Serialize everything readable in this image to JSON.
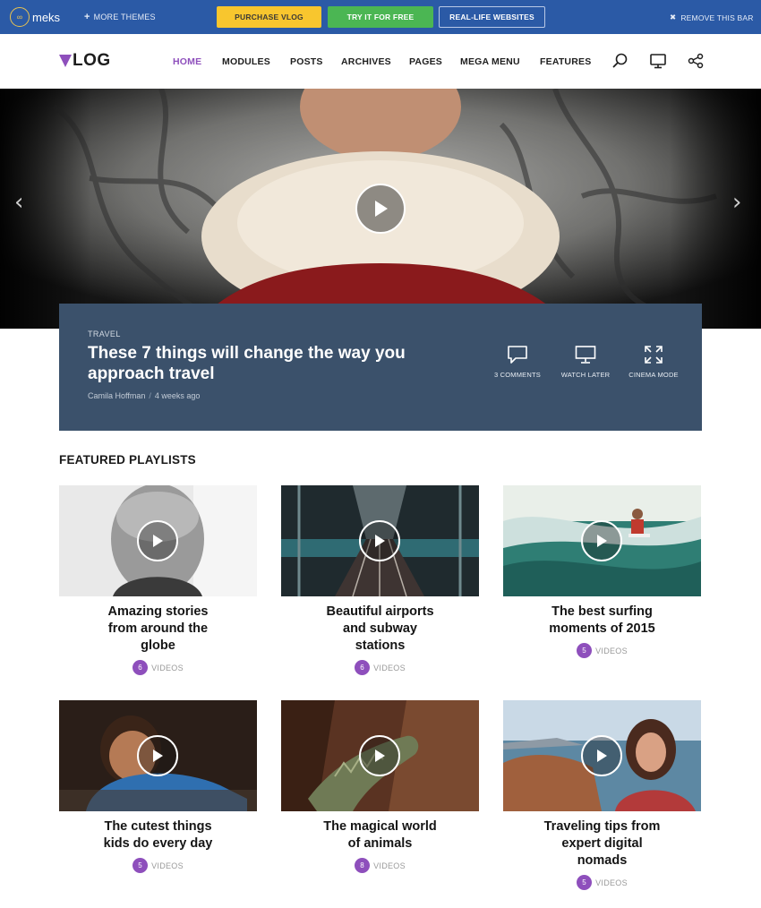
{
  "topbar": {
    "brand": "meks",
    "more_themes": "MORE THEMES",
    "purchase": "PURCHASE VLOG",
    "try_free": "TRY IT FOR FREE",
    "real_life": "REAL-LIFE WEBSITES",
    "remove": "REMOVE THIS BAR"
  },
  "header": {
    "logo": "LOG",
    "nav": [
      "HOME",
      "MODULES",
      "POSTS",
      "ARCHIVES",
      "PAGES",
      "MEGA MENU",
      "FEATURES"
    ],
    "active": "HOME"
  },
  "hero": {
    "category": "TRAVEL",
    "title": "These 7 things will change the way you approach travel",
    "author": "Camila Hoffman",
    "time": "4 weeks ago",
    "actions": {
      "comments": "3 COMMENTS",
      "watch_later": "WATCH LATER",
      "cinema": "CINEMA MODE"
    }
  },
  "playlists": {
    "heading": "FEATURED PLAYLISTS",
    "videos_label": "VIDEOS",
    "items": [
      {
        "title": "Amazing stories from around the globe",
        "count": "6"
      },
      {
        "title": "Beautiful airports and subway stations",
        "count": "6"
      },
      {
        "title": "The best surfing moments of 2015",
        "count": "5"
      },
      {
        "title": "The cutest things kids do every day",
        "count": "5"
      },
      {
        "title": "The magical world of animals",
        "count": "8"
      },
      {
        "title": "Traveling tips from expert digital nomads",
        "count": "5"
      }
    ]
  },
  "colors": {
    "accent": "#8e4fbc",
    "topbar": "#2b5aa6",
    "infobox": "#3b516b",
    "purchase": "#f8c62e",
    "try_free": "#4bb653"
  }
}
